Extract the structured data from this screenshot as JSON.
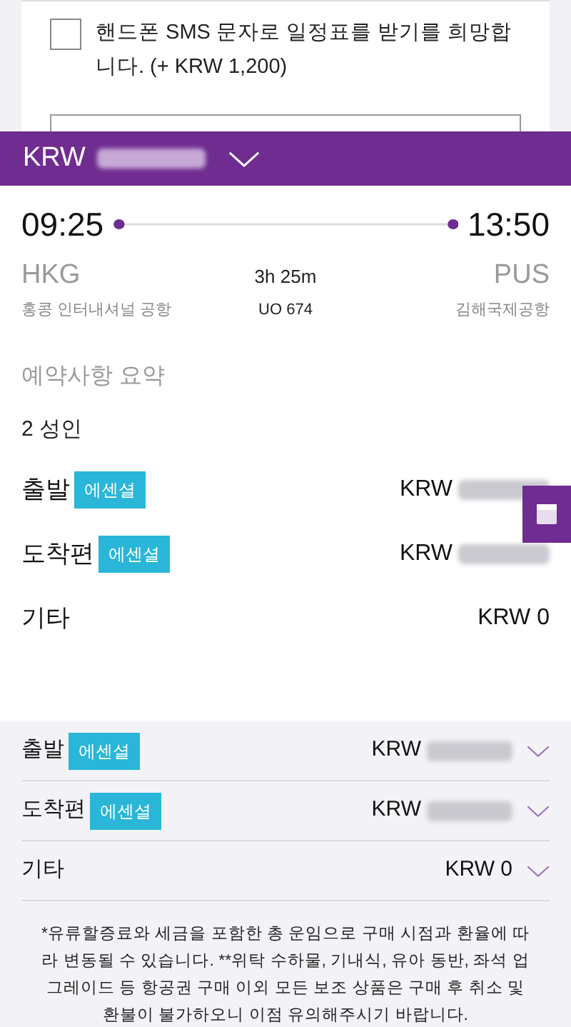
{
  "sms_option": {
    "label": "핸드폰 SMS 문자로 일정표를 받기를 희망합니다. (+ KRW 1,200)",
    "checked": false
  },
  "total_bar": {
    "currency": "KRW",
    "expanded": false
  },
  "flight": {
    "departure_time": "09:25",
    "arrival_time": "13:50",
    "origin_code": "HKG",
    "origin_name": "홍콩 인터내셔널 공항",
    "duration": "3h 25m",
    "flight_number": "UO 674",
    "destination_code": "PUS",
    "destination_name": "김해국제공항"
  },
  "summary": {
    "title": "예약사항 요약",
    "passengers": "2 성인",
    "rows": [
      {
        "label": "출발",
        "badge": "에센셜",
        "currency": "KRW"
      },
      {
        "label": "도착편",
        "badge": "에센셜",
        "currency": "KRW"
      },
      {
        "label": "기타",
        "amount": "KRW 0"
      }
    ]
  },
  "breakdown": {
    "rows": [
      {
        "label": "출발",
        "badge": "에센셜",
        "currency": "KRW",
        "expanded": false
      },
      {
        "label": "도착편",
        "badge": "에센셜",
        "currency": "KRW",
        "expanded": false
      },
      {
        "label": "기타",
        "amount": "KRW 0",
        "expanded": false
      }
    ],
    "note": "*유류할증료와 세금을 포함한 총 운임으로 구매 시점과 환율에 따라 변동될 수 있습니다. **위탁 수하물, 기내식, 유아 동반, 좌석 업그레이드 등 항공권 구매 이외 모든 보조 상품은 구매 후 취소 및 환불이 불가하오니 이점 유의해주시기 바랍니다."
  }
}
